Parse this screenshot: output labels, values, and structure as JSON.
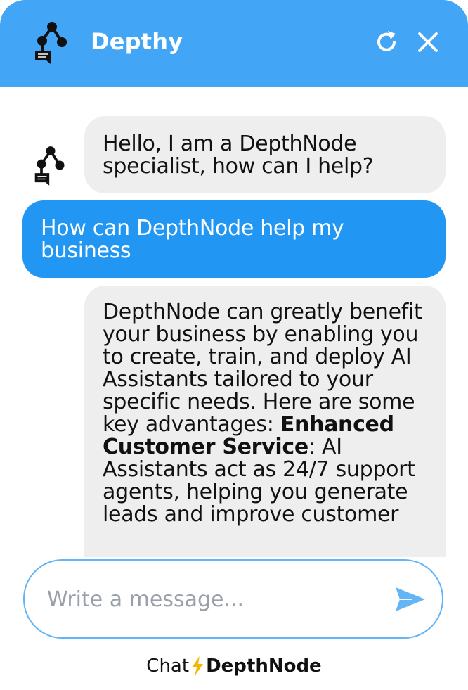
{
  "header": {
    "title": "Depthy",
    "logo_icon": "node-graph-icon",
    "refresh_icon": "refresh-icon",
    "close_icon": "close-icon"
  },
  "messages": [
    {
      "role": "bot",
      "text": "Hello, I am a DepthNode specialist, how can I help?"
    },
    {
      "role": "user",
      "text": "How can DepthNode help my business"
    },
    {
      "role": "bot",
      "text_intro": "DepthNode can greatly benefit your business by enabling you to create, train, and deploy AI Assistants tailored to your specific needs. Here are some key advantages:",
      "bold_heading": "Enhanced Customer Service",
      "text_rest": ": AI Assistants act as 24/7 support agents, helping you generate leads and improve customer"
    }
  ],
  "input": {
    "placeholder": "Write a message...",
    "value": "",
    "send_icon": "send-icon"
  },
  "footer": {
    "prefix": "Chat",
    "brand": "DepthNode",
    "bolt_icon": "lightning-icon"
  },
  "colors": {
    "header_bg": "#42a5f5",
    "user_bubble": "#2196f3",
    "bot_bubble": "#eeeeee",
    "accent": "#64b5f6",
    "bolt": "#f5b800"
  }
}
